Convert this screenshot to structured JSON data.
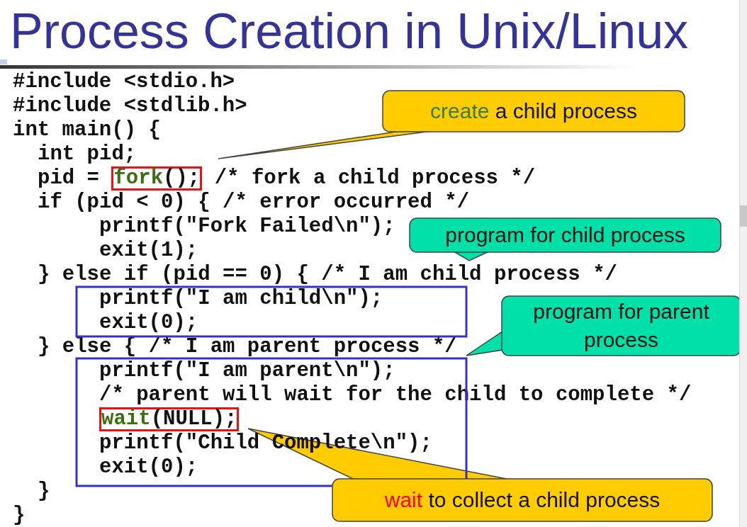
{
  "title": "Process Creation in Unix/Linux",
  "code_lines": [
    {
      "segments": [
        {
          "text": "#include <stdio.h>"
        }
      ]
    },
    {
      "segments": [
        {
          "text": "#include <stdlib.h>"
        }
      ]
    },
    {
      "segments": [
        {
          "text": "int main() {"
        }
      ],
      "children": [
        {
          "segments": [
            {
              "text": "int pid;"
            }
          ]
        },
        {
          "segments": [
            {
              "text": "pid = "
            },
            {
              "boxed": true,
              "parts": [
                {
                  "text": "fork",
                  "color": "#3c6e14"
                },
                {
                  "text": "();"
                }
              ]
            },
            {
              "text": " /* fork a child process */"
            }
          ]
        },
        {
          "segments": [
            {
              "text": "if (pid < 0) { /* error occurred */"
            }
          ],
          "children": [
            {
              "segments": [
                {
                  "text": "printf(\"Fork Failed\\n\");"
                }
              ]
            },
            {
              "segments": [
                {
                  "text": "exit(1);"
                }
              ]
            }
          ]
        },
        {
          "segments": [
            {
              "text": "} else if (pid == 0) { /* I am child process */"
            }
          ],
          "children": [
            {
              "segments": [
                {
                  "text": "printf(\"I am child\\n\");"
                }
              ]
            },
            {
              "segments": [
                {
                  "text": "exit(0);"
                }
              ]
            }
          ]
        },
        {
          "segments": [
            {
              "text": "} else { /* I am parent process */"
            }
          ],
          "children": [
            {
              "segments": [
                {
                  "text": "printf(\"I am parent\\n\");"
                }
              ]
            },
            {
              "segments": [
                {
                  "text": "/* parent will wait for the child to complete */"
                }
              ]
            },
            {
              "segments": [
                {
                  "boxed": true,
                  "parts": [
                    {
                      "text": "wait",
                      "color": "#3c6e14"
                    },
                    {
                      "text": "(NULL);"
                    }
                  ]
                }
              ]
            },
            {
              "segments": [
                {
                  "text": "printf(\"Child Complete\\n\");"
                }
              ]
            },
            {
              "segments": [
                {
                  "text": "exit(0);"
                }
              ]
            }
          ]
        },
        {
          "segments": [
            {
              "text": "}"
            }
          ]
        }
      ]
    },
    {
      "segments": [
        {
          "text": "}"
        }
      ]
    }
  ],
  "callouts": [
    {
      "color": "#ffcc00",
      "segments": [
        {
          "text": "create",
          "color": "#3c7a14"
        },
        {
          "text": " a child process"
        }
      ]
    },
    {
      "color": "#00e0a8",
      "segments": [
        {
          "text": "program for child process"
        }
      ]
    },
    {
      "color": "#00e0a8",
      "segments": [
        {
          "text": "program for parent process"
        }
      ]
    },
    {
      "color": "#ffcc00",
      "segments": [
        {
          "text": "wait",
          "color": "#ff0000"
        },
        {
          "text": " to collect a child process"
        }
      ]
    }
  ]
}
